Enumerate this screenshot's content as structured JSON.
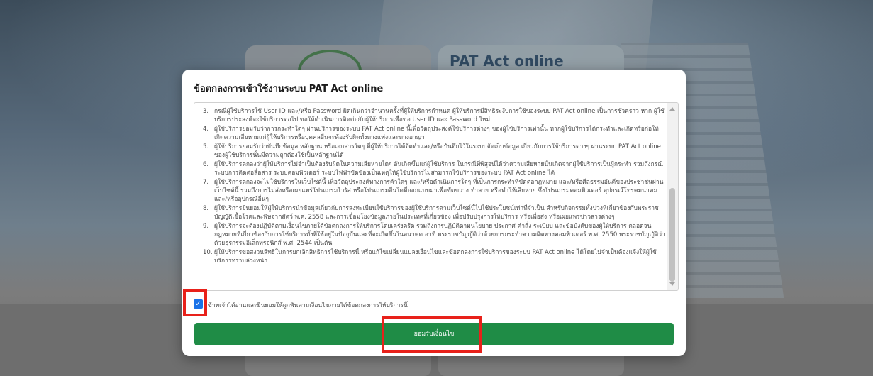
{
  "background": {
    "title": "PAT Act online"
  },
  "modal": {
    "title": "ข้อตกลงการเข้าใช้งานระบบ PAT Act online",
    "terms": [
      {
        "num": "3.",
        "text": "กรณีผู้ใช้บริการใช้ User ID และ/หรือ Password ผิดเกินกว่าจำนวนครั้งที่ผู้ให้บริการกำหนด ผู้ให้บริการมีสิทธิระงับการใช้ของระบบ PAT Act online เป็นการชั่วคราว หาก ผู้ใช้บริการประสงค์จะใช้บริการต่อไป ขอให้ดำเนินการติดต่อกับผู้ให้บริการเพื่อขอ User ID และ Password ใหม่"
      },
      {
        "num": "4.",
        "text": "ผู้ใช้บริการยอมรับว่าการกระทำใดๆ ผ่านบริการของระบบ PAT Act online นี้เพื่อวัตถุประสงค์ใช้บริการต่างๆ ของผู้ใช้บริการเท่านั้น หากผู้ใช้บริการได้กระทำและเกิดหรือก่อให้เกิดความเสียหายแก่ผู้ให้บริการหรือบุคคลอื่นจะต้องรับผิดทั้งทางแพ่งและทางอาญา"
      },
      {
        "num": "5.",
        "text": "ผู้ใช้บริการยอมรับว่าบันทึกข้อมูล หลักฐาน หรือเอกสารใดๆ ที่ผู้ให้บริการได้จัดทำและ/หรือบันทึกไว้ในระบบจัดเก็บข้อมูล เกี่ยวกับการใช้บริการต่างๆ ผ่านระบบ PAT Act online ของผู้ใช้บริการนั้นมีความถูกต้องใช้เป็นหลักฐานได้"
      },
      {
        "num": "6.",
        "text": "ผู้ใช้บริการตกลงว่าผู้ให้บริการไม่จำเป็นต้องรับผิดในความเสียหายใดๆ อันเกิดขึ้นแก่ผู้ใช้บริการ ในกรณีที่พิสูจน์ได้ว่าความเสียหายนั้นเกิดจากผู้ใช้บริการเป็นผู้กระทำ รวมถึงกรณีระบบการติดต่อสื่อสาร ระบบคอมพิวเตอร์ ระบบไฟฟ้าขัดข้องเป็นเหตุให้ผู้ใช้บริการไม่สามารถใช้บริการของระบบ PAT Act online ได้"
      },
      {
        "num": "7.",
        "text": "ผู้ใช้บริการตกลงจะไม่ใช้บริการในเว็บไซต์นี้ เพื่อวัตถุประสงค์ทางการค้าใดๆ และ/หรือดำเนินการใดๆ ที่เป็นการกระทำที่ขัดต่อกฎหมาย และ/หรือศีลธรรมอันดีของประชาชนผ่านเว็บไซต์นี้ รวมถึงการไม่ส่งหรือเผยแพร่โปรแกรมไวรัส หรือโปรแกรมอื่นใดที่ออกแบบมาเพื่อขัดขวาง ทำลาย หรือทำให้เสียหาย ซึ่งโปรแกรมคอมพิวเตอร์ อุปกรณ์โทรคมนาคมและ/หรืออุปกรณ์อื่นๆ"
      },
      {
        "num": "8.",
        "text": "ผู้ใช้บริการยินยอมให้ผู้ให้บริการนำข้อมูลเกี่ยวกับการลงทะเบียนใช้บริการของผู้ใช้บริการตามเว็บไซต์นี้ไปใช้ประโยชน์เท่าที่จำเป็น สำหรับกิจกรรมทั้งปวงที่เกี่ยวข้องกับพระราชบัญญัติเชื้อโรคและพิษจากสัตว์ พ.ศ. 2558 และการเชื่อมโยงข้อมูลภายในประเทศที่เกี่ยวข้อง เพื่อปรับปรุงการให้บริการ หรือเพื่อส่ง หรือเผยแพร่ข่าวสารต่างๆ"
      },
      {
        "num": "9.",
        "text": "ผู้ใช้บริการจะต้องปฏิบัติตามเงื่อนไขภายใต้ข้อตกลงการให้บริการโดยเคร่งครัด รวมถึงการปฏิบัติตามนโยบาย ประกาศ คำสั่ง ระเบียบ และข้อบังคับของผู้ให้บริการ ตลอดจนกฎหมายที่เกี่ยวข้องกับการใช้บริการทั้งที่ใช้อยู่ในปัจจุบันและที่จะเกิดขึ้นในอนาคต อาทิ พระราชบัญญัติว่าด้วยการกระทำความผิดทางคอมพิวเตอร์ พ.ศ. 2550 พระราชบัญญัติว่าด้วยธุรกรรมอิเล็กทรอนิกส์ พ.ศ. 2544 เป็นต้น"
      },
      {
        "num": "10.",
        "text": "ผู้ให้บริการขอสงวนสิทธิในการยกเลิกสิทธิการใช้บริการนี้ หรือแก้ไขเปลี่ยนแปลงเงื่อนไขและข้อตกลงการใช้บริการของระบบ PAT Act online ได้โดยไม่จำเป็นต้องแจ้งให้ผู้ใช้บริการทราบล่วงหน้า"
      }
    ],
    "agree_checked": "✓",
    "agree_label": "ข้าพเจ้าได้อ่านและยินยอมให้ผูกพันตามเงื่อนไขภายใต้ข้อตกลงการให้บริการนี้",
    "accept_button": "ยอมรับเงื่อนไข"
  },
  "colors": {
    "accent_green": "#1f8c46",
    "checkbox_blue": "#1a73e8",
    "highlight_red": "#e8211a"
  }
}
